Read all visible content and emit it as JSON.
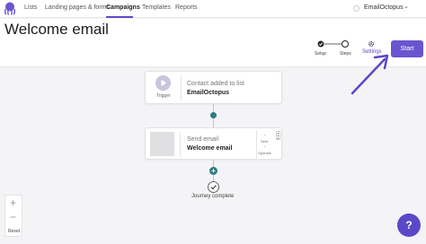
{
  "nav": {
    "links": [
      "Lists",
      "Landing pages & forms",
      "Campaigns",
      "Templates",
      "Reports"
    ],
    "active": "Campaigns",
    "account_name": "EmailOctopus",
    "account_chevron": "⌄"
  },
  "header": {
    "title": "Welcome email",
    "steps": [
      "Setup",
      "Steps",
      "Settings"
    ],
    "start_label": "Start"
  },
  "journey": {
    "trigger": {
      "badge": "Trigger",
      "subtitle": "Contact added to list",
      "name": "EmailOctopus"
    },
    "email": {
      "subtitle": "Send email",
      "name": "Welcome email",
      "sent_value": "-",
      "sent_label": "Sent",
      "opened_value": "-",
      "opened_label": "Opened"
    },
    "add_symbol": "+",
    "complete_label": "Journey complete"
  },
  "zoom": {
    "plus": "+",
    "minus": "−",
    "reset_label": "Reset"
  },
  "help": {
    "symbol": "?"
  },
  "colors": {
    "brand": "#6a55cf",
    "node": "#2e7d81"
  }
}
